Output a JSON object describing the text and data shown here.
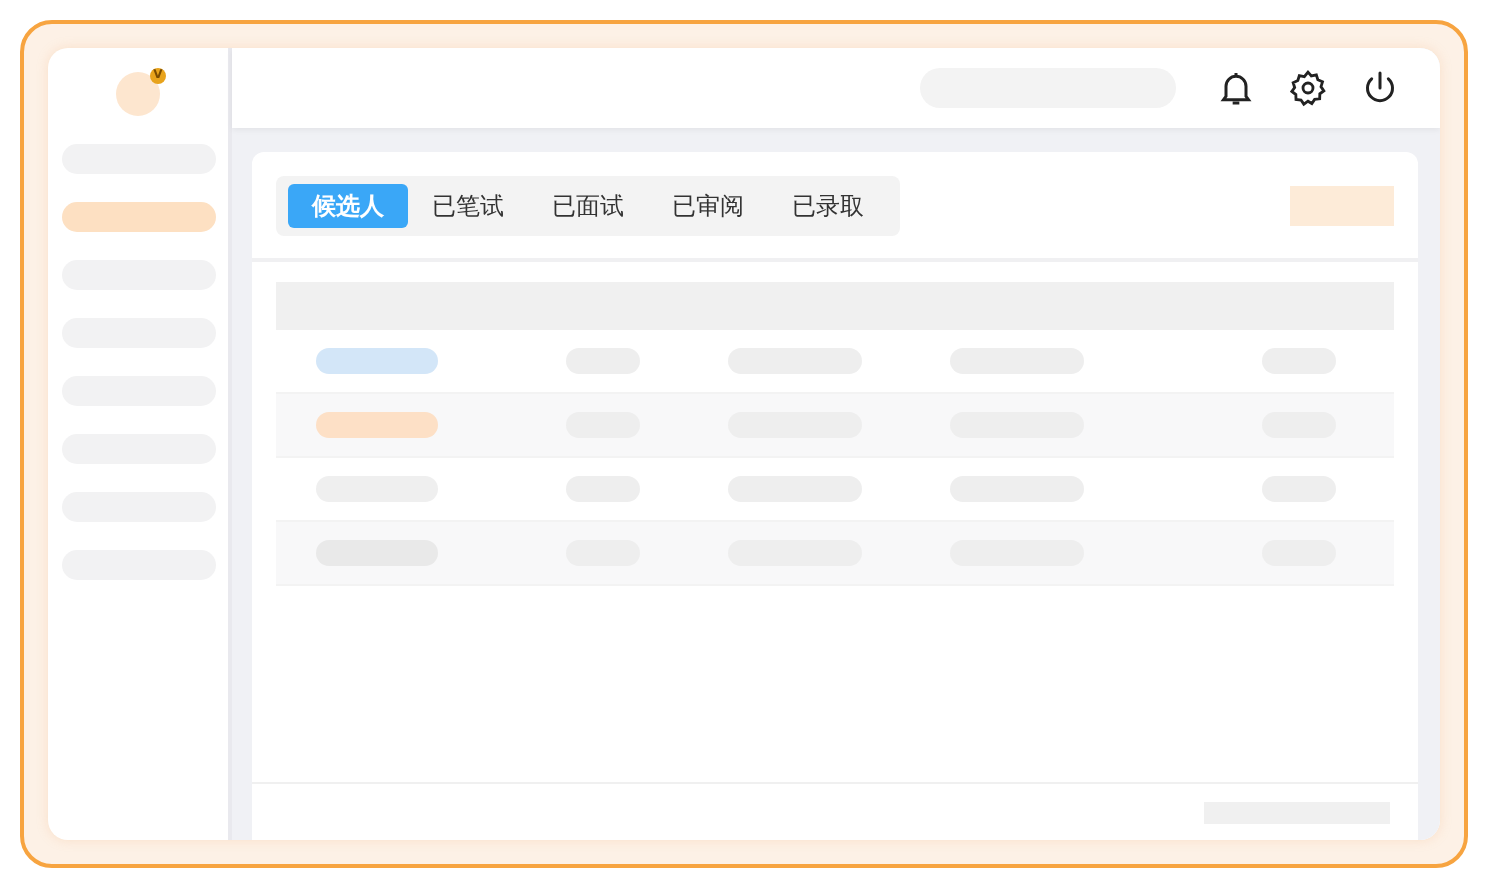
{
  "avatar": {
    "badge": "V"
  },
  "sidebar": {
    "items": [
      {
        "selected": false
      },
      {
        "selected": true
      },
      {
        "selected": false
      },
      {
        "selected": false
      },
      {
        "selected": false
      },
      {
        "selected": false
      },
      {
        "selected": false
      },
      {
        "selected": false
      }
    ]
  },
  "tabs": [
    {
      "label": "候选人",
      "selected": true
    },
    {
      "label": "已笔试",
      "selected": false
    },
    {
      "label": "已面试",
      "selected": false
    },
    {
      "label": "已审阅",
      "selected": false
    },
    {
      "label": "已录取",
      "selected": false
    }
  ],
  "table": {
    "rows": [
      {
        "color": "#d3e6f8"
      },
      {
        "color": "#fde0c6"
      },
      {
        "color": "#efefef"
      },
      {
        "color": "#e9e9e9"
      }
    ]
  }
}
